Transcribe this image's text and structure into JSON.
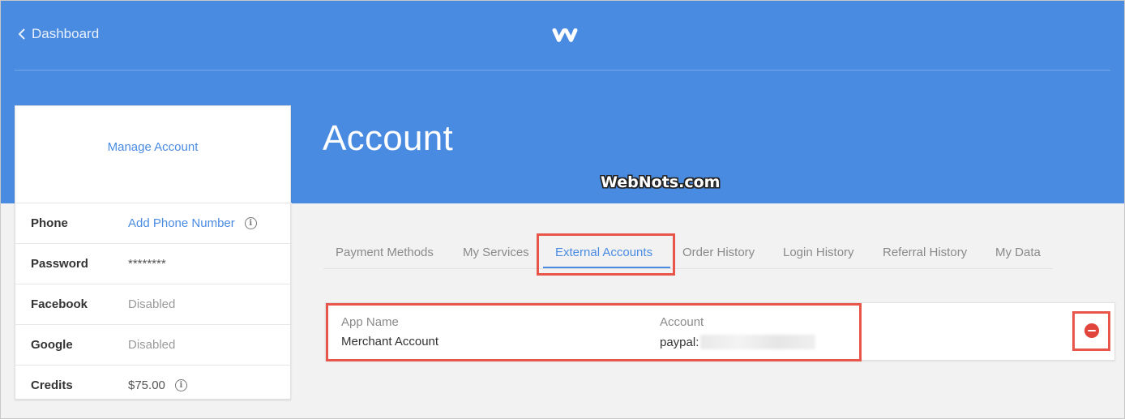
{
  "nav": {
    "back_label": "Dashboard"
  },
  "header": {
    "title": "Account",
    "logo_icon": "weebly-w-logo"
  },
  "watermark": "WebNots.com",
  "sidebar": {
    "manage_label": "Manage Account",
    "rows": [
      {
        "label": "Phone",
        "value": "Add Phone Number",
        "info": "i"
      },
      {
        "label": "Password",
        "value": "********"
      },
      {
        "label": "Facebook",
        "value": "Disabled"
      },
      {
        "label": "Google",
        "value": "Disabled"
      },
      {
        "label": "Credits",
        "value": "$75.00",
        "info": "i"
      }
    ]
  },
  "tabs": [
    {
      "label": "Payment Methods"
    },
    {
      "label": "My Services"
    },
    {
      "label": "External Accounts",
      "active": true
    },
    {
      "label": "Order History"
    },
    {
      "label": "Login History"
    },
    {
      "label": "Referral History"
    },
    {
      "label": "My Data"
    }
  ],
  "external_accounts": {
    "columns": [
      "App Name",
      "Account"
    ],
    "rows": [
      {
        "app_name": "Merchant Account",
        "account": "paypal:"
      }
    ]
  },
  "colors": {
    "header_bg": "#4a8be2",
    "accent": "#4a8be2",
    "highlight_box": "#e8554a",
    "remove_button": "#e0443a"
  }
}
